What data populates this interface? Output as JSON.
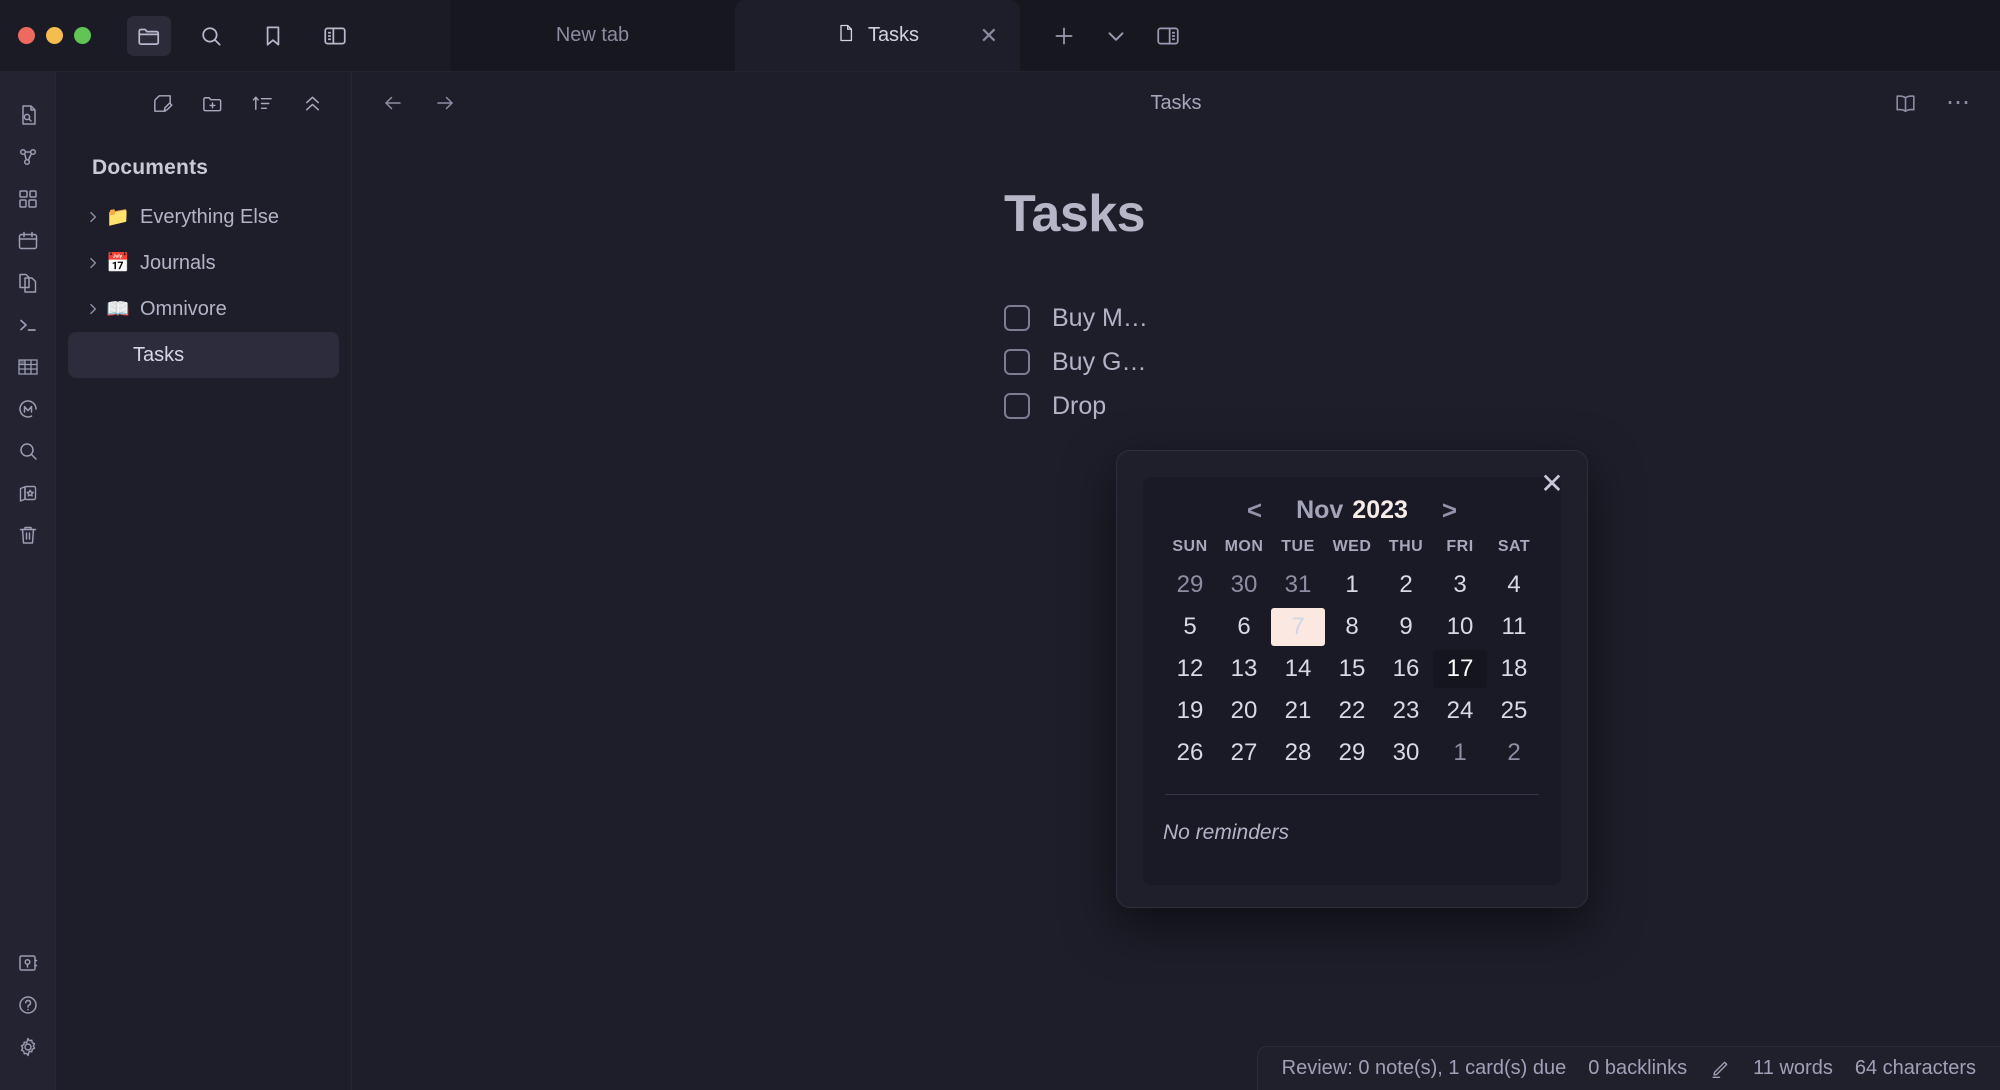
{
  "window": {
    "traffic_lights": [
      "close",
      "minimize",
      "maximize"
    ],
    "toolbar_icons": [
      {
        "name": "folder-icon",
        "active": true
      },
      {
        "name": "search-icon",
        "active": false
      },
      {
        "name": "bookmark-icon",
        "active": false
      },
      {
        "name": "left-sidebar-toggle-icon",
        "active": false
      }
    ],
    "toolbar_right_icons": [
      "plus-icon",
      "chevron-down-icon",
      "right-sidebar-toggle-icon"
    ]
  },
  "tabs": [
    {
      "label": "New tab",
      "active": false,
      "icon": ""
    },
    {
      "label": "Tasks",
      "active": true,
      "icon": "document-icon",
      "close": "✕"
    }
  ],
  "rail": {
    "top_items": [
      {
        "name": "file-search-icon",
        "label": "File search"
      },
      {
        "name": "graph-icon",
        "label": "Graph view"
      },
      {
        "name": "dashboard-icon",
        "label": "Dashboard"
      },
      {
        "name": "calendar-icon",
        "label": "Calendar"
      },
      {
        "name": "files-icon",
        "label": "Files"
      },
      {
        "name": "terminal-icon",
        "label": "Terminal"
      },
      {
        "name": "table-icon",
        "label": "Table"
      },
      {
        "name": "mermaid-icon",
        "label": "Mermaid"
      },
      {
        "name": "search-icon",
        "label": "Search"
      },
      {
        "name": "flashcards-icon",
        "label": "Flashcards"
      },
      {
        "name": "trash-icon",
        "label": "Trash"
      }
    ],
    "bottom_items": [
      {
        "name": "vault-icon",
        "label": "Vault"
      },
      {
        "name": "help-icon",
        "label": "Help"
      },
      {
        "name": "settings-icon",
        "label": "Settings"
      }
    ]
  },
  "sidebar": {
    "toolbar": [
      {
        "name": "new-note-icon",
        "label": "New note"
      },
      {
        "name": "new-folder-icon",
        "label": "New folder"
      },
      {
        "name": "sort-icon",
        "label": "Sort"
      },
      {
        "name": "collapse-all-icon",
        "label": "Collapse all"
      }
    ],
    "title": "Documents",
    "items": [
      {
        "label": "Everything Else",
        "emoji": "📁",
        "expandable": true,
        "selected": false
      },
      {
        "label": "Journals",
        "emoji": "📅",
        "expandable": true,
        "selected": false
      },
      {
        "label": "Omnivore",
        "emoji": "📖",
        "expandable": true,
        "selected": false
      },
      {
        "label": "Tasks",
        "emoji": "",
        "expandable": false,
        "selected": true
      }
    ]
  },
  "document": {
    "header_title": "Tasks",
    "nav_back": "←",
    "nav_forward": "→",
    "header_right_icons": [
      "reading-mode-icon",
      "more-options-icon"
    ],
    "title": "Tasks",
    "tasks": [
      {
        "text": "Buy M…",
        "checked": false
      },
      {
        "text": "Buy G…",
        "checked": false
      },
      {
        "text": "Drop",
        "checked": false
      }
    ]
  },
  "calendar": {
    "close_label": "✕",
    "prev_label": "<",
    "next_label": ">",
    "month": "Nov",
    "year": "2023",
    "weekdays": [
      "SUN",
      "MON",
      "TUE",
      "WED",
      "THU",
      "FRI",
      "SAT"
    ],
    "weeks": [
      [
        {
          "d": "29",
          "state": "muted"
        },
        {
          "d": "30",
          "state": "muted"
        },
        {
          "d": "31",
          "state": "muted"
        },
        {
          "d": "1",
          "state": "normal"
        },
        {
          "d": "2",
          "state": "normal"
        },
        {
          "d": "3",
          "state": "normal"
        },
        {
          "d": "4",
          "state": "normal"
        }
      ],
      [
        {
          "d": "5",
          "state": "normal"
        },
        {
          "d": "6",
          "state": "normal"
        },
        {
          "d": "7",
          "state": "today"
        },
        {
          "d": "8",
          "state": "normal"
        },
        {
          "d": "9",
          "state": "normal"
        },
        {
          "d": "10",
          "state": "normal"
        },
        {
          "d": "11",
          "state": "normal"
        }
      ],
      [
        {
          "d": "12",
          "state": "normal"
        },
        {
          "d": "13",
          "state": "normal"
        },
        {
          "d": "14",
          "state": "normal"
        },
        {
          "d": "15",
          "state": "normal"
        },
        {
          "d": "16",
          "state": "normal"
        },
        {
          "d": "17",
          "state": "selected"
        },
        {
          "d": "18",
          "state": "normal"
        }
      ],
      [
        {
          "d": "19",
          "state": "normal"
        },
        {
          "d": "20",
          "state": "normal"
        },
        {
          "d": "21",
          "state": "normal"
        },
        {
          "d": "22",
          "state": "normal"
        },
        {
          "d": "23",
          "state": "normal"
        },
        {
          "d": "24",
          "state": "normal"
        },
        {
          "d": "25",
          "state": "normal"
        }
      ],
      [
        {
          "d": "26",
          "state": "normal"
        },
        {
          "d": "27",
          "state": "normal"
        },
        {
          "d": "28",
          "state": "normal"
        },
        {
          "d": "29",
          "state": "normal"
        },
        {
          "d": "30",
          "state": "normal"
        },
        {
          "d": "1",
          "state": "muted"
        },
        {
          "d": "2",
          "state": "muted"
        }
      ]
    ],
    "reminders_empty": "No reminders"
  },
  "statusbar": {
    "review": "Review: 0 note(s), 1 card(s) due",
    "backlinks": "0 backlinks",
    "pencil_icon": "edit-icon",
    "words": "11 words",
    "characters": "64 characters"
  },
  "colors": {
    "app_bg": "#1b1b26",
    "panel_bg": "#1e1e2b",
    "rail_bg": "#232331",
    "today_highlight": "#fbe9e1",
    "selected_day": "#15151f",
    "accent_text": "#f7ece6"
  }
}
